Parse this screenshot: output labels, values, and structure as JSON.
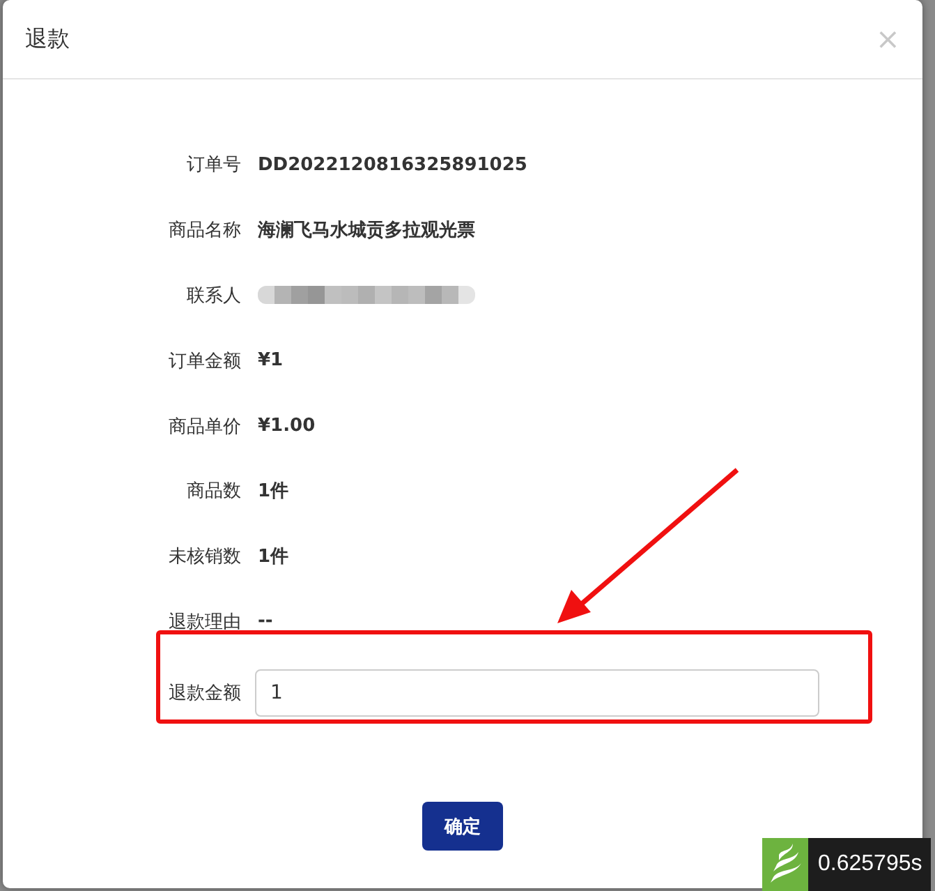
{
  "dialog": {
    "title": "退款",
    "close": "×",
    "fields": [
      {
        "kind": "text",
        "label": "订单号",
        "value": "DD2022120816325891025"
      },
      {
        "kind": "text",
        "label": "商品名称",
        "value": "海澜飞马水城贡多拉观光票"
      },
      {
        "kind": "redacted",
        "label": "联系人"
      },
      {
        "kind": "text",
        "label": "订单金额",
        "value": "¥1"
      },
      {
        "kind": "text",
        "label": "商品单价",
        "value": "¥1.00"
      },
      {
        "kind": "text",
        "label": "商品数",
        "value": "1件"
      },
      {
        "kind": "text",
        "label": "未核销数",
        "value": "1件"
      },
      {
        "kind": "text",
        "label": "退款理由",
        "value": "--"
      },
      {
        "kind": "input",
        "label": "退款金额",
        "value": "1"
      }
    ],
    "confirm": "确定"
  },
  "timing_badge": {
    "value": "0.625795s"
  }
}
